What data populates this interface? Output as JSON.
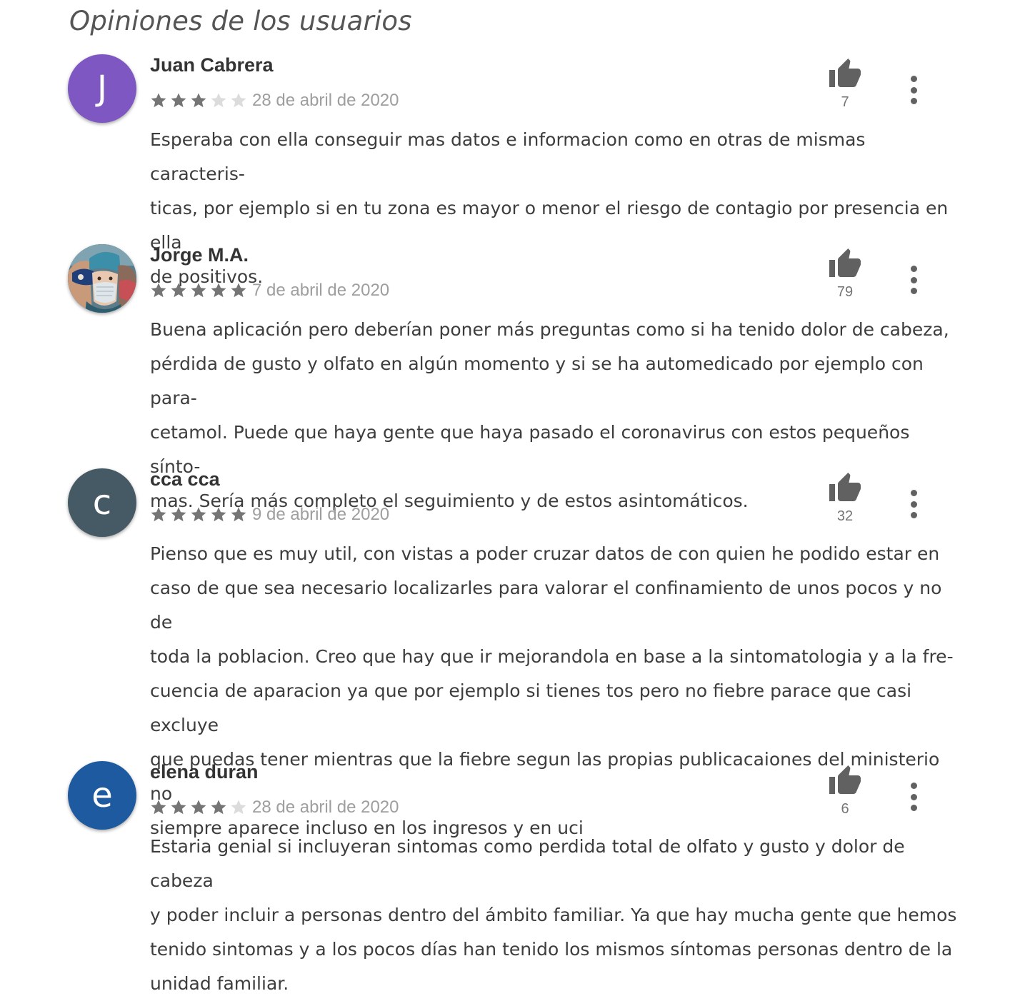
{
  "section": {
    "title": "Opiniones de los usuarios"
  },
  "colors": {
    "star_filled": "#757575",
    "star_empty": "#dcdcdc",
    "thumb": "#616161"
  },
  "reviews": [
    {
      "name": "Juan Cabrera",
      "avatar_letter": "J",
      "avatar_color": "#7e57c2",
      "rating": 3,
      "date": "28 de abril de 2020",
      "helpful_count": "7",
      "text": "Esperaba con ella conseguir mas datos e informacion como en otras de mismas caracteris-\nticas, por ejemplo si en tu zona es mayor o menor el riesgo de contagio por presencia en ella\nde positivos."
    },
    {
      "name": "Jorge M.A.",
      "avatar_letter": "",
      "avatar_color": "#4a6a7a",
      "avatar_image": "illustrated-masked-faces-avatar",
      "rating": 5,
      "date": "7 de abril de 2020",
      "helpful_count": "79",
      "text": "Buena aplicación pero deberían poner más preguntas como si ha tenido dolor de cabeza,\npérdida de gusto y olfato en algún momento y si se ha automedicado por ejemplo con para-\ncetamol. Puede que haya gente que haya pasado el coronavirus con estos pequeños sínto-\nmas. Sería más completo el seguimiento y de estos asintomáticos."
    },
    {
      "name": "cca cca",
      "avatar_letter": "c",
      "avatar_color": "#455a64",
      "rating": 5,
      "date": "9 de abril de 2020",
      "helpful_count": "32",
      "text": "Pienso que es muy util, con vistas a poder cruzar datos de con quien he podido estar en\ncaso de que sea necesario localizarles para valorar el confinamiento de unos pocos y no de\ntoda la poblacion. Creo que hay que ir mejorandola en base a la sintomatologia y a la fre-\ncuencia de aparacion ya que por ejemplo si tienes tos pero no fiebre parace que casi excluye\nque puedas tener mientras que la fiebre segun las propias publicacaiones del ministerio no\nsiempre aparece incluso en los ingresos y en uci"
    },
    {
      "name": "elena duran",
      "avatar_letter": "e",
      "avatar_color": "#1e5aa0",
      "rating": 4,
      "date": "28 de abril de 2020",
      "helpful_count": "6",
      "text": "Estaria genial si incluyeran sintomas como perdida total de olfato y gusto y dolor de cabeza\ny poder incluir a personas dentro del ámbito familiar. Ya que hay mucha gente que hemos\ntenido sintomas y a los pocos días han tenido los mismos síntomas personas dentro de la\nunidad familiar."
    }
  ]
}
